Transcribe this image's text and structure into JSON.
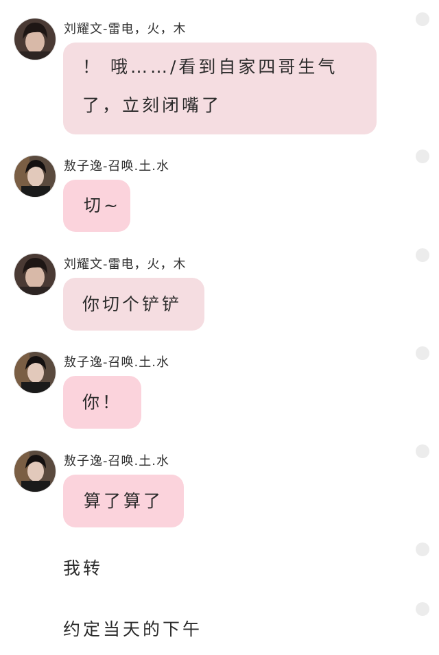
{
  "colors": {
    "bubble_liu": "#f5dde1",
    "bubble_ao": "#fbd3dc",
    "select_radio": "#ececec"
  },
  "messages": [
    {
      "speaker": "刘耀文-雷电，火，木",
      "text_line1": "！ 哦……/看到自家四哥生气",
      "text_line2": "了，立刻闭嘴了"
    },
    {
      "speaker": "敖子逸-召唤.土.水",
      "text": "切~"
    },
    {
      "speaker": "刘耀文-雷电，火，木",
      "text": "你切个铲铲"
    },
    {
      "speaker": "敖子逸-召唤.土.水",
      "text": "你！"
    },
    {
      "speaker": "敖子逸-召唤.土.水",
      "text": "算了算了"
    }
  ],
  "narration": [
    {
      "text": "我转"
    },
    {
      "text": "约定当天的下午"
    }
  ]
}
